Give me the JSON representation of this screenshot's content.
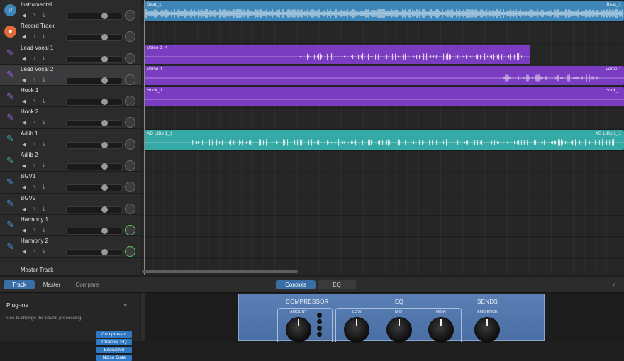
{
  "tracks": [
    {
      "name": "Instrumental",
      "icon": "music-note-icon",
      "color": "#3f86b8",
      "selected": false,
      "pan_active": false
    },
    {
      "name": "Record Track",
      "icon": "record-icon",
      "color": "#e06a3a",
      "selected": false,
      "pan_active": false
    },
    {
      "name": "Lead Vocal 1",
      "icon": "microphone-icon",
      "color": "#9b5de5",
      "selected": false,
      "pan_active": false
    },
    {
      "name": "Lead Vocal 2",
      "icon": "microphone-icon",
      "color": "#9b5de5",
      "selected": true,
      "pan_active": false
    },
    {
      "name": "Hook 1",
      "icon": "microphone-icon",
      "color": "#9b5de5",
      "selected": false,
      "pan_active": false
    },
    {
      "name": "Hook 2",
      "icon": "microphone-icon",
      "color": "#9b5de5",
      "selected": false,
      "pan_active": false
    },
    {
      "name": "Adlib 1",
      "icon": "microphone-icon",
      "color": "#35a9a6",
      "selected": false,
      "pan_active": false
    },
    {
      "name": "Adlib 2",
      "icon": "microphone-icon",
      "color": "#35a9a6",
      "selected": false,
      "pan_active": false
    },
    {
      "name": "BGV1",
      "icon": "microphone-icon",
      "color": "#4a8fe0",
      "selected": false,
      "pan_active": false
    },
    {
      "name": "BGV2",
      "icon": "microphone-icon",
      "color": "#4a8fe0",
      "selected": false,
      "pan_active": false
    },
    {
      "name": "Harmony 1",
      "icon": "microphone-icon",
      "color": "#4a8fe0",
      "selected": false,
      "pan_active": true
    },
    {
      "name": "Harmony 2",
      "icon": "microphone-icon",
      "color": "#4a8fe0",
      "selected": false,
      "pan_active": true
    }
  ],
  "master_track": {
    "name": "Master Track"
  },
  "regions": [
    {
      "track": 0,
      "name": "Beat_1",
      "name_right": "Beat_1",
      "color": "blue"
    },
    {
      "track": 2,
      "name": "Verse 1_4",
      "name_right": "",
      "color": "purple"
    },
    {
      "track": 3,
      "name": "Verse 1",
      "name_right": "Verse 1",
      "color": "purple"
    },
    {
      "track": 4,
      "name": "Hook_1",
      "name_right": "Hook_1",
      "color": "purple"
    },
    {
      "track": 6,
      "name": "AD LIBs 1_1",
      "name_right": "AD LIBs 1_1",
      "color": "teal"
    }
  ],
  "bottom_tabs": {
    "track": "Track",
    "master": "Master",
    "compare": "Compare",
    "controls": "Controls",
    "eq": "EQ"
  },
  "plugins": {
    "title": "Plug-ins",
    "description": "Use to change the sound processing.",
    "items": [
      "Compressor",
      "Channel EQ",
      "Bitcrusher",
      "Noise Gate"
    ]
  },
  "smart_controls": {
    "compressor": {
      "title": "COMPRESSOR",
      "knob_label": "AMOUNT"
    },
    "eq": {
      "title": "EQ",
      "labels": [
        "LOW",
        "MID",
        "HIGH"
      ]
    },
    "sends": {
      "title": "SENDS",
      "knob_label": "AMBIENCE"
    }
  }
}
